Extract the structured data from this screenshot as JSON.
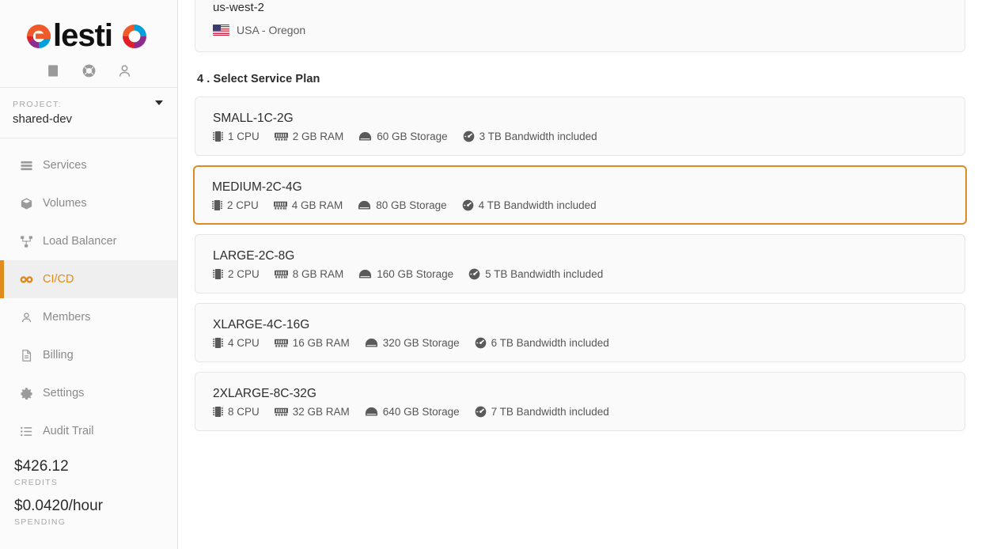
{
  "brand": {
    "name": "elestio",
    "accent_orange": "#e08c1c",
    "selected_border": "#d98d22"
  },
  "sidebar": {
    "utility_icons": [
      {
        "name": "docs-icon",
        "label": "Documentation"
      },
      {
        "name": "support-icon",
        "label": "Support"
      },
      {
        "name": "account-icon",
        "label": "Account"
      }
    ],
    "project": {
      "label": "PROJECT:",
      "value": "shared-dev"
    },
    "nav_items": [
      {
        "label": "Services",
        "icon": "services-icon",
        "active": false
      },
      {
        "label": "Volumes",
        "icon": "volumes-icon",
        "active": false
      },
      {
        "label": "Load Balancer",
        "icon": "load-balancer-icon",
        "active": false
      },
      {
        "label": "CI/CD",
        "icon": "cicd-infinity-icon",
        "active": true
      },
      {
        "label": "Members",
        "icon": "members-icon",
        "active": false
      },
      {
        "label": "Billing",
        "icon": "billing-icon",
        "active": false
      },
      {
        "label": "Settings",
        "icon": "settings-gear-icon",
        "active": false
      },
      {
        "label": "Audit Trail",
        "icon": "audit-trail-icon",
        "active": false
      }
    ],
    "credits": {
      "amount": "$426.12",
      "label": "CREDITS"
    },
    "spending": {
      "amount": "$0.0420/hour",
      "label": "SPENDING"
    }
  },
  "main": {
    "region": {
      "name": "us-west-2",
      "location": "USA - Oregon",
      "flag": "us-flag-icon"
    },
    "plan_section": {
      "heading": "4 . Select Service Plan",
      "spec_icons": {
        "cpu": "cpu-chip-icon",
        "ram": "ram-memory-icon",
        "storage": "storage-drive-icon",
        "bandwidth": "speedometer-icon"
      },
      "plans": [
        {
          "name": "SMALL-1C-2G",
          "cpu": "1 CPU",
          "ram": "2 GB RAM",
          "storage": "60 GB Storage",
          "bandwidth": "3 TB Bandwidth included",
          "selected": false
        },
        {
          "name": "MEDIUM-2C-4G",
          "cpu": "2 CPU",
          "ram": "4 GB RAM",
          "storage": "80 GB Storage",
          "bandwidth": "4 TB Bandwidth included",
          "selected": true
        },
        {
          "name": "LARGE-2C-8G",
          "cpu": "2 CPU",
          "ram": "8 GB RAM",
          "storage": "160 GB Storage",
          "bandwidth": "5 TB Bandwidth included",
          "selected": false
        },
        {
          "name": "XLARGE-4C-16G",
          "cpu": "4 CPU",
          "ram": "16 GB RAM",
          "storage": "320 GB Storage",
          "bandwidth": "6 TB Bandwidth included",
          "selected": false
        },
        {
          "name": "2XLARGE-8C-32G",
          "cpu": "8 CPU",
          "ram": "32 GB RAM",
          "storage": "640 GB Storage",
          "bandwidth": "7 TB Bandwidth included",
          "selected": false
        }
      ]
    }
  }
}
